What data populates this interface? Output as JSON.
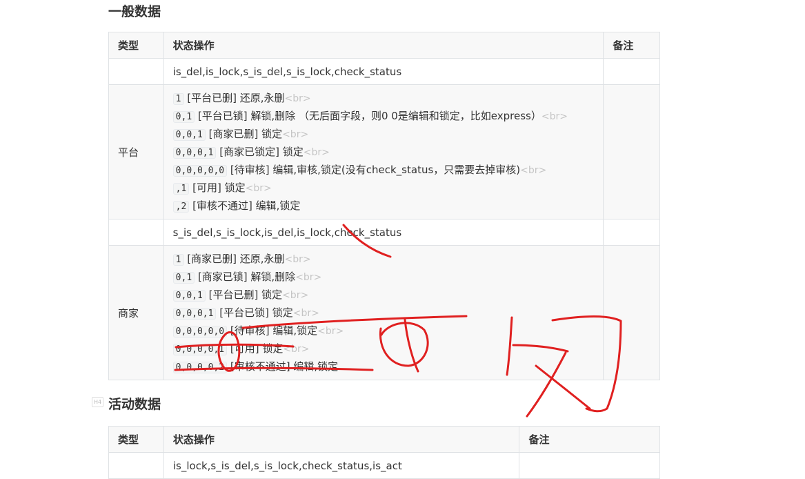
{
  "section1": {
    "title": "一般数据",
    "headers": [
      "类型",
      "状态操作",
      "备注"
    ],
    "row_fields_platform": "is_del,is_lock,s_is_del,s_is_lock,check_status",
    "platform_label": "平台",
    "platform_lines": [
      {
        "code": "1",
        "text": "[平台已删] 还原,永删",
        "br": "<br>"
      },
      {
        "code": "0,1",
        "text": "[平台已锁] 解锁,删除   （无后面字段，则0 0是编辑和锁定，比如express）",
        "br": "<br>"
      },
      {
        "code": "0,0,1",
        "text": "[商家已删] 锁定",
        "br": "<br>"
      },
      {
        "code": "0,0,0,1",
        "text": "[商家已锁定] 锁定",
        "br": "<br>"
      },
      {
        "code": "0,0,0,0,0",
        "text": "[待审核] 编辑,审核,锁定(没有check_status，只需要去掉审核)",
        "br": "<br>"
      },
      {
        "code": ",1",
        "text": "[可用] 锁定",
        "br": "<br>"
      },
      {
        "code": ",2",
        "text": "[审核不通过] 编辑,锁定",
        "br": ""
      }
    ],
    "row_fields_merchant": "s_is_del,s_is_lock,is_del,is_lock,check_status",
    "merchant_label": "商家",
    "merchant_lines": [
      {
        "code": "1",
        "text": "[商家已删] 还原,永删",
        "br": "<br>"
      },
      {
        "code": "0,1",
        "text": "[商家已锁] 解锁,删除",
        "br": "<br>"
      },
      {
        "code": "0,0,1",
        "text": "[平台已删] 锁定",
        "br": "<br>"
      },
      {
        "code": "0,0,0,1",
        "text": "[平台已锁] 锁定",
        "br": "<br>"
      },
      {
        "code": "0,0,0,0,0",
        "text": "[待审核] 编辑,锁定",
        "br": "<br>"
      },
      {
        "code": "0,0,0,0,1",
        "text": "[可用] 锁定",
        "br": "<br>"
      },
      {
        "code": "0,0,0,0,2",
        "text": "[审核不通过] 编辑,锁定",
        "br": ""
      }
    ]
  },
  "section2": {
    "badge": "H4",
    "title": "活动数据",
    "headers": [
      "类型",
      "状态操作",
      "备注"
    ],
    "row_fields": "is_lock,s_is_del,s_is_lock,check_status,is_act"
  },
  "ink_color": "#e02020"
}
